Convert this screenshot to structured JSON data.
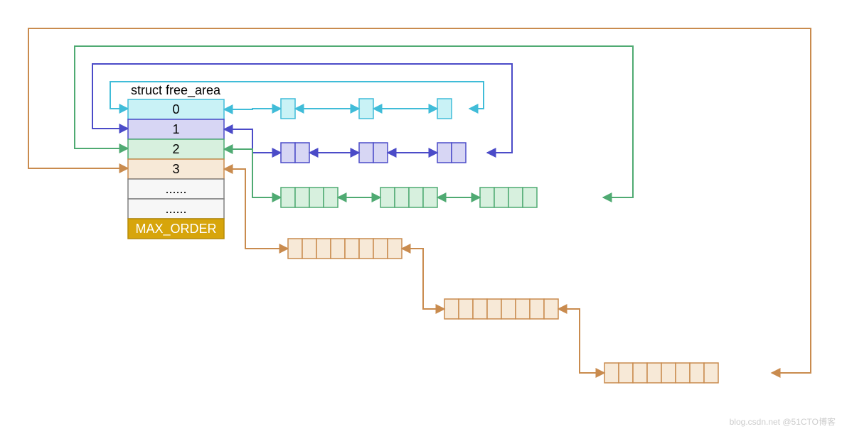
{
  "diagram": {
    "title": "struct free_area",
    "colors": {
      "order0_fill": "#c9f2f6",
      "order0_stroke": "#40bcd8",
      "order1_fill": "#d7d6f4",
      "order1_stroke": "#4b4bc8",
      "order2_fill": "#d7f0de",
      "order2_stroke": "#4faa72",
      "order3_fill": "#f7e9d7",
      "order3_stroke": "#c98b4e",
      "ellipsis_fill": "#f7f7f7",
      "ellipsis_stroke": "#808080",
      "max_fill": "#d7a50b",
      "max_stroke": "#b78b09",
      "max_text": "#ffffff"
    },
    "rows": [
      {
        "key": "order0",
        "label": "0"
      },
      {
        "key": "order1",
        "label": "1"
      },
      {
        "key": "order2",
        "label": "2"
      },
      {
        "key": "order3",
        "label": "3"
      },
      {
        "key": "ellipsis1",
        "label": "......"
      },
      {
        "key": "ellipsis2",
        "label": "......"
      },
      {
        "key": "max",
        "label": "MAX_ORDER"
      }
    ],
    "lists": {
      "order0": {
        "block_pages": 1,
        "nodes": 3
      },
      "order1": {
        "block_pages": 2,
        "nodes": 3
      },
      "order2": {
        "block_pages": 4,
        "nodes": 3
      },
      "order3": {
        "block_pages": 8,
        "nodes": 3
      }
    }
  },
  "watermark": "blog.csdn.net @51CTO博客"
}
